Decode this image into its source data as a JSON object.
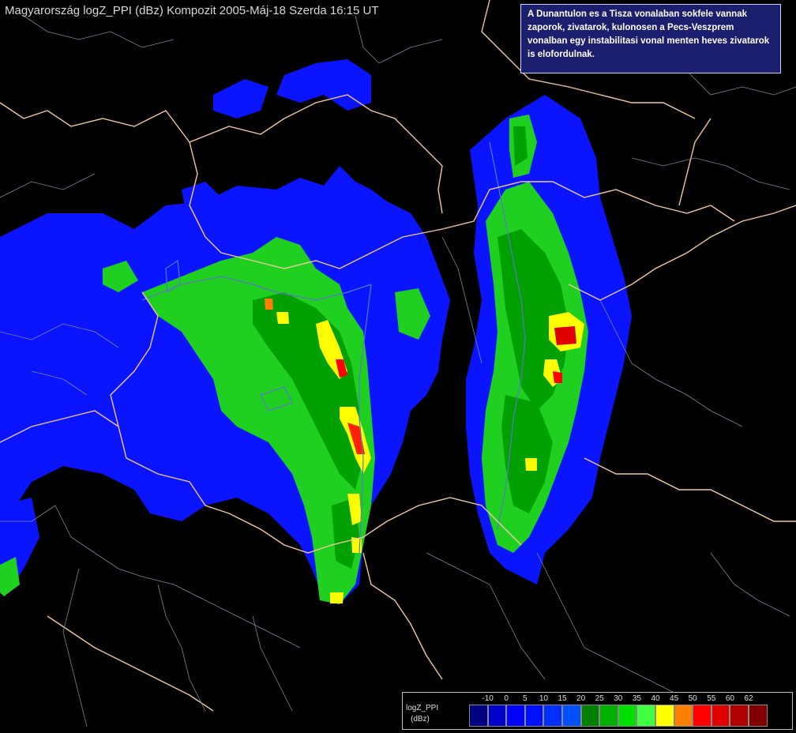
{
  "title": "Magyarország logZ_PPI (dBz)  Kompozit  2005-Máj-18 Szerda 16:15 UT",
  "note": "A Dunantulon es a Tisza vonalaban sokfele vannak zaporok, zivatarok, kulonosen a Pecs-Veszprem vonalban egy instabilitasi vonal menten heves zivatarok is elofordulnak.",
  "legend": {
    "label_line1": "logZ_PPI",
    "label_line2": "(dBz)",
    "ticks": [
      "-10",
      "0",
      "5",
      "10",
      "15",
      "20",
      "25",
      "30",
      "35",
      "40",
      "45",
      "50",
      "55",
      "60",
      "62"
    ],
    "colors": [
      "#000080",
      "#0000c8",
      "#0000ff",
      "#0010ff",
      "#0030ff",
      "#0050ff",
      "#008000",
      "#00b000",
      "#00e000",
      "#40ff40",
      "#ffff00",
      "#ff8000",
      "#ff0000",
      "#e00000",
      "#b00000",
      "#800000"
    ]
  },
  "colors": {
    "border": "#f0c8a0",
    "rivers": "#5a78c8",
    "counties": "#7a8a9a",
    "note_bg": "#1c1f6e"
  }
}
